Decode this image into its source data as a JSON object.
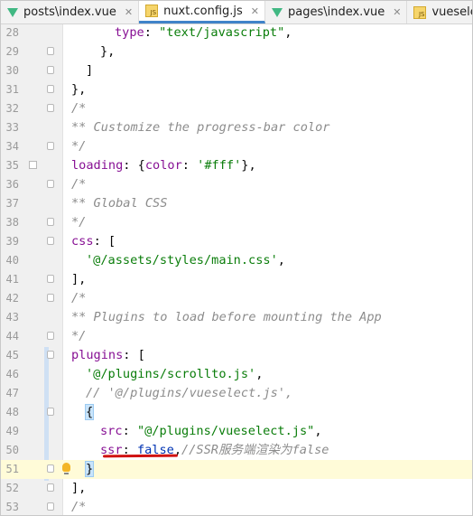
{
  "tabs": [
    {
      "label": "posts\\index.vue",
      "icon": "vue-icon",
      "active": false
    },
    {
      "label": "nuxt.config.js",
      "icon": "js-icon",
      "active": true
    },
    {
      "label": "pages\\index.vue",
      "icon": "vue-icon",
      "active": false
    },
    {
      "label": "vueselect.js",
      "icon": "js-icon",
      "active": false
    }
  ],
  "lines": [
    {
      "n": "28",
      "y": 0
    },
    {
      "n": "29"
    },
    {
      "n": "30"
    },
    {
      "n": "31"
    },
    {
      "n": "32"
    },
    {
      "n": "33"
    },
    {
      "n": "34"
    },
    {
      "n": "35"
    },
    {
      "n": "36"
    },
    {
      "n": "37"
    },
    {
      "n": "38"
    },
    {
      "n": "39"
    },
    {
      "n": "40"
    },
    {
      "n": "41"
    },
    {
      "n": "42"
    },
    {
      "n": "43"
    },
    {
      "n": "44"
    },
    {
      "n": "45"
    },
    {
      "n": "46"
    },
    {
      "n": "47"
    },
    {
      "n": "48"
    },
    {
      "n": "49"
    },
    {
      "n": "50"
    },
    {
      "n": "51"
    },
    {
      "n": "52"
    },
    {
      "n": "53"
    }
  ],
  "code": {
    "l28_key": "type",
    "l28_rest": ": ",
    "l28_str": "\"text/javascript\"",
    "l28_end": ",",
    "l29": "},",
    "l30": "]",
    "l31": "},",
    "l32": "/*",
    "l33": "** Customize the progress-bar color",
    "l34": "*/",
    "l35_key": "loading",
    "l35_mid": ": {",
    "l35_key2": "color",
    "l35_mid2": ": ",
    "l35_str": "'#fff'",
    "l35_end": "},",
    "l36": "/*",
    "l37": "** Global CSS",
    "l38": "*/",
    "l39_key": "css",
    "l39_rest": ": [",
    "l40_str": "'@/assets/styles/main.css'",
    "l40_end": ",",
    "l41": "],",
    "l42": "/*",
    "l43": "** Plugins to load before mounting the App",
    "l44": "*/",
    "l45_key": "plugins",
    "l45_rest": ": [",
    "l46_str": "'@/plugins/scrollto.js'",
    "l46_end": ",",
    "l47": "// '@/plugins/vueselect.js',",
    "l48": "{",
    "l49_key": "src",
    "l49_mid": ": ",
    "l49_str": "\"@/plugins/vueselect.js\"",
    "l49_end": ",",
    "l50_key": "ssr",
    "l50_mid": ": ",
    "l50_lit": "false",
    "l50_end": ",",
    "l50_cm": "//SSR服务端渲染为false",
    "l51": "}",
    "l52": "],",
    "l53": "/*"
  }
}
